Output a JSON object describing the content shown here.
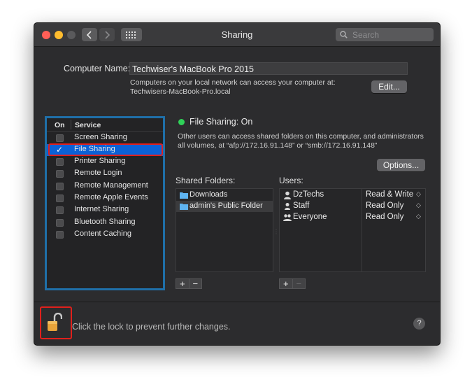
{
  "window": {
    "title": "Sharing"
  },
  "search": {
    "placeholder": "Search"
  },
  "computer_name": {
    "label": "Computer Name:",
    "value": "Techwiser's MacBook Pro 2015",
    "desc_line1": "Computers on your local network can access your computer at:",
    "desc_line2": "Techwisers-MacBook-Pro.local",
    "edit_label": "Edit..."
  },
  "services": {
    "header_on": "On",
    "header_service": "Service",
    "items": [
      {
        "label": "Screen Sharing",
        "checked": false
      },
      {
        "label": "File Sharing",
        "checked": true
      },
      {
        "label": "Printer Sharing",
        "checked": false
      },
      {
        "label": "Remote Login",
        "checked": false
      },
      {
        "label": "Remote Management",
        "checked": false
      },
      {
        "label": "Remote Apple Events",
        "checked": false
      },
      {
        "label": "Internet Sharing",
        "checked": false
      },
      {
        "label": "Bluetooth Sharing",
        "checked": false
      },
      {
        "label": "Content Caching",
        "checked": false
      }
    ]
  },
  "status": {
    "text": "File Sharing: On",
    "desc_line1": "Other users can access shared folders on this computer, and administrators",
    "desc_line2": "all volumes, at “afp://172.16.91.148” or “smb://172.16.91.148”",
    "color": "#2fd158"
  },
  "options_label": "Options...",
  "shared_folders": {
    "label": "Shared Folders:",
    "items": [
      "Downloads",
      "admin's Public Folder"
    ]
  },
  "users": {
    "label": "Users:",
    "items": [
      {
        "name": "DzTechs",
        "permission": "Read & Write"
      },
      {
        "name": "Staff",
        "permission": "Read Only"
      },
      {
        "name": "Everyone",
        "permission": "Read Only"
      }
    ]
  },
  "plus_minus": {
    "plus": "+",
    "minus": "−"
  },
  "lock": {
    "text": "Click the lock to prevent further changes.",
    "icon": "unlocked-padlock-icon"
  },
  "help": {
    "label": "?"
  }
}
